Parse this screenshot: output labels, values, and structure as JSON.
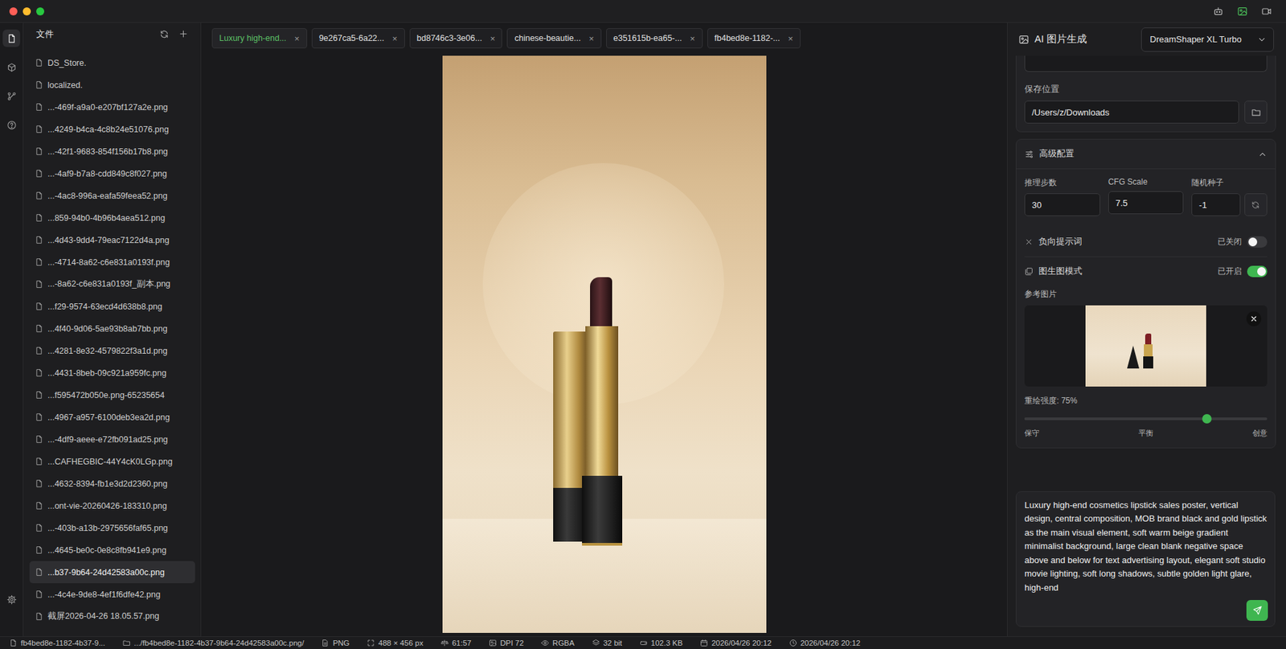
{
  "window": {
    "traffic_lights": [
      {
        "color": "#ff5f57"
      },
      {
        "color": "#febc2e"
      },
      {
        "color": "#28c840"
      }
    ],
    "top_icons": [
      {
        "kind": "bot",
        "selected": false
      },
      {
        "kind": "image",
        "selected": true
      },
      {
        "kind": "video",
        "selected": false
      }
    ]
  },
  "rail": {
    "items": [
      {
        "kind": "files",
        "selected": true
      },
      {
        "kind": "cube",
        "selected": false
      },
      {
        "kind": "flow",
        "selected": false
      },
      {
        "kind": "help",
        "selected": false
      }
    ],
    "bottom": [
      {
        "kind": "settings",
        "selected": false
      }
    ]
  },
  "file_panel": {
    "title": "文件",
    "files": [
      {
        "name": "DS_Store.",
        "selected": false
      },
      {
        "name": "localized.",
        "selected": false
      },
      {
        "name": "...-469f-a9a0-e207bf127a2e.png",
        "selected": false
      },
      {
        "name": "...4249-b4ca-4c8b24e51076.png",
        "selected": false
      },
      {
        "name": "...-42f1-9683-854f156b17b8.png",
        "selected": false
      },
      {
        "name": "...-4af9-b7a8-cdd849c8f027.png",
        "selected": false
      },
      {
        "name": "...-4ac8-996a-eafa59feea52.png",
        "selected": false
      },
      {
        "name": "...859-94b0-4b96b4aea512.png",
        "selected": false
      },
      {
        "name": "...4d43-9dd4-79eac7122d4a.png",
        "selected": false
      },
      {
        "name": "...-4714-8a62-c6e831a0193f.png",
        "selected": false
      },
      {
        "name": "...-8a62-c6e831a0193f_副本.png",
        "selected": false
      },
      {
        "name": "...f29-9574-63ecd4d638b8.png",
        "selected": false
      },
      {
        "name": "...4f40-9d06-5ae93b8ab7bb.png",
        "selected": false
      },
      {
        "name": "...4281-8e32-4579822f3a1d.png",
        "selected": false
      },
      {
        "name": "...4431-8beb-09c921a959fc.png",
        "selected": false
      },
      {
        "name": "...f595472b050e.png-65235654",
        "selected": false
      },
      {
        "name": "...4967-a957-6100deb3ea2d.png",
        "selected": false
      },
      {
        "name": "...-4df9-aeee-e72fb091ad25.png",
        "selected": false
      },
      {
        "name": "...CAFHEGBIC-44Y4cK0LGp.png",
        "selected": false
      },
      {
        "name": "...4632-8394-fb1e3d2d2360.png",
        "selected": false
      },
      {
        "name": "...ont-vie-20260426-183310.png",
        "selected": false
      },
      {
        "name": "...-403b-a13b-2975656faf65.png",
        "selected": false
      },
      {
        "name": "...4645-be0c-0e8c8fb941e9.png",
        "selected": false
      },
      {
        "name": "...b37-9b64-24d42583a00c.png",
        "selected": true
      },
      {
        "name": "...-4c4e-9de8-4ef1f6dfe42.png",
        "selected": false
      },
      {
        "name": "截屏2026-04-26 18.05.57.png",
        "selected": false
      }
    ]
  },
  "tabs": [
    {
      "label": "Luxury high-end...",
      "selected": true,
      "close": "×"
    },
    {
      "label": "9e267ca5-6a22...",
      "selected": false,
      "close": "×"
    },
    {
      "label": "bd8746c3-3e06...",
      "selected": false,
      "close": "×"
    },
    {
      "label": "chinese-beautie...",
      "selected": false,
      "close": "×"
    },
    {
      "label": "e351615b-ea65-...",
      "selected": false,
      "close": "×"
    },
    {
      "label": "fb4bed8e-1182-...",
      "selected": false,
      "close": "×"
    }
  ],
  "right_panel": {
    "title": "AI 图片生成",
    "model": "DreamShaper XL Turbo",
    "save_location": {
      "label": "保存位置",
      "value": "/Users/z/Downloads"
    },
    "advanced": {
      "title": "高级配置",
      "expanded": true,
      "fields": [
        {
          "label": "推理步数",
          "value": "30"
        },
        {
          "label": "CFG Scale",
          "value": "7.5"
        },
        {
          "label": "随机种子",
          "value": "-1"
        }
      ],
      "negative_prompt": {
        "label": "负向提示词",
        "status": "已关闭",
        "on": false
      },
      "img2img": {
        "label": "图生图模式",
        "status": "已开启",
        "on": true
      },
      "reference": {
        "label": "参考图片"
      },
      "strength": {
        "label": "重绘强度: 75%",
        "level": 0.75,
        "ticks": [
          "保守",
          "平衡",
          "创意"
        ]
      }
    },
    "prompt": "Luxury high-end cosmetics lipstick sales poster, vertical design, central composition, MOB brand black and gold lipstick as the main visual element, soft warm beige gradient minimalist background, large clean blank negative space above and below for text advertising layout, elegant soft studio movie lighting, soft long shadows, subtle golden light glare, high-end"
  },
  "status_bar": [
    {
      "kind": "file",
      "text": "fb4bed8e-1182-4b37-9..."
    },
    {
      "kind": "folder",
      "text": ".../fb4bed8e-1182-4b37-9b64-24d42583a00c.png/"
    },
    {
      "kind": "format",
      "text": "PNG"
    },
    {
      "kind": "size",
      "text": "488 × 456 px"
    },
    {
      "kind": "ratio",
      "text": "61:57"
    },
    {
      "kind": "dpi",
      "text": "DPI 72"
    },
    {
      "kind": "color",
      "text": "RGBA"
    },
    {
      "kind": "depth",
      "text": "32 bit"
    },
    {
      "kind": "disk",
      "text": "102.3 KB"
    },
    {
      "kind": "date",
      "text": "2026/04/26 20:12"
    },
    {
      "kind": "clock",
      "text": "2026/04/26 20:12"
    }
  ]
}
